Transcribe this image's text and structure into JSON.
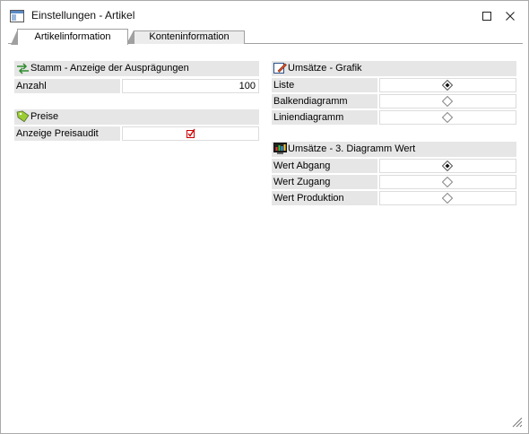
{
  "window": {
    "title": "Einstellungen - Artikel"
  },
  "tabs": [
    {
      "label": "Artikelinformation",
      "active": true
    },
    {
      "label": "Konteninformation",
      "active": false
    }
  ],
  "left": {
    "stamm": {
      "header": "Stamm - Anzeige der Ausprägungen",
      "icon": "arrows-icon",
      "rows": [
        {
          "label": "Anzahl",
          "value": "100"
        }
      ]
    },
    "preise": {
      "header": "Preise",
      "icon": "price-tag-icon",
      "rows": [
        {
          "label": "Anzeige Preisaudit",
          "checked": true
        }
      ]
    }
  },
  "right": {
    "grafik": {
      "header": "Umsätze - Grafik",
      "icon": "chart-edit-icon",
      "rows": [
        {
          "label": "Liste",
          "selected": true
        },
        {
          "label": "Balkendiagramm",
          "selected": false
        },
        {
          "label": "Liniendiagramm",
          "selected": false
        }
      ]
    },
    "diagramm": {
      "header": "Umsätze - 3. Diagramm Wert",
      "icon": "monitor-chart-icon",
      "rows": [
        {
          "label": "Wert Abgang",
          "selected": true
        },
        {
          "label": "Wert Zugang",
          "selected": false
        },
        {
          "label": "Wert Produktion",
          "selected": false
        }
      ]
    }
  },
  "colors": {
    "header_bg": "#e6e6e6",
    "check_red": "#cc0000"
  }
}
